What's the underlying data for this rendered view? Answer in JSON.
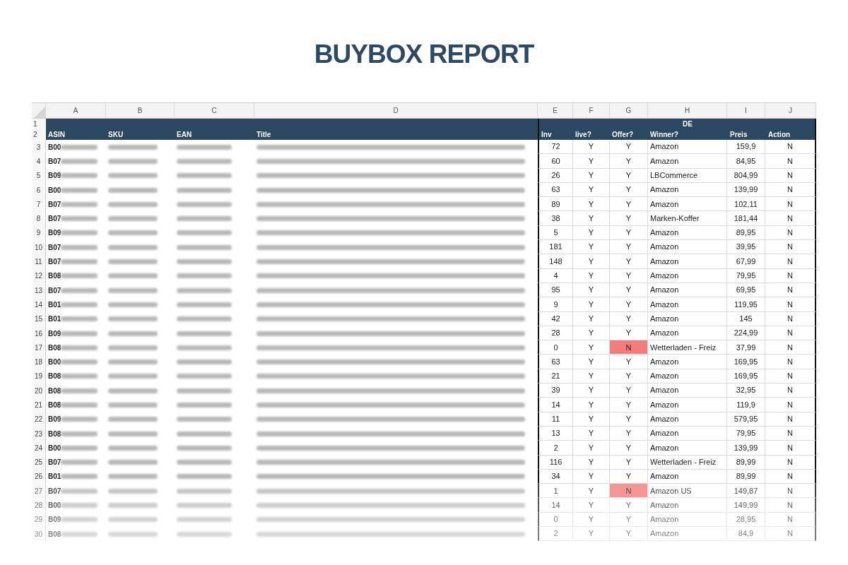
{
  "title": "BUYBOX REPORT",
  "column_letters": [
    "A",
    "B",
    "C",
    "D",
    "E",
    "F",
    "G",
    "H",
    "I",
    "J"
  ],
  "header": {
    "row_numbers": [
      "1",
      "2"
    ],
    "group_label": "DE",
    "columns": [
      "ASIN",
      "SKU",
      "EAN",
      "Title",
      "Inv",
      "live?",
      "Offer?",
      "Winner?",
      "Preis",
      "Action"
    ]
  },
  "rows": [
    {
      "number": "3",
      "asin": "B00",
      "inv": "72",
      "live": "Y",
      "offer": "Y",
      "offer_alert": false,
      "winner": "Amazon",
      "preis": "159,9",
      "action": "N"
    },
    {
      "number": "4",
      "asin": "B07",
      "inv": "60",
      "live": "Y",
      "offer": "Y",
      "offer_alert": false,
      "winner": "Amazon",
      "preis": "84,95",
      "action": "N"
    },
    {
      "number": "5",
      "asin": "B09",
      "inv": "26",
      "live": "Y",
      "offer": "Y",
      "offer_alert": false,
      "winner": "LBCommerce",
      "preis": "804,99",
      "action": "N"
    },
    {
      "number": "6",
      "asin": "B00",
      "inv": "63",
      "live": "Y",
      "offer": "Y",
      "offer_alert": false,
      "winner": "Amazon",
      "preis": "139,99",
      "action": "N"
    },
    {
      "number": "7",
      "asin": "B07",
      "inv": "89",
      "live": "Y",
      "offer": "Y",
      "offer_alert": false,
      "winner": "Amazon",
      "preis": "102,11",
      "action": "N"
    },
    {
      "number": "8",
      "asin": "B07",
      "inv": "38",
      "live": "Y",
      "offer": "Y",
      "offer_alert": false,
      "winner": "Marken-Koffer",
      "preis": "181,44",
      "action": "N"
    },
    {
      "number": "9",
      "asin": "B09",
      "inv": "5",
      "live": "Y",
      "offer": "Y",
      "offer_alert": false,
      "winner": "Amazon",
      "preis": "89,95",
      "action": "N"
    },
    {
      "number": "10",
      "asin": "B07",
      "inv": "181",
      "live": "Y",
      "offer": "Y",
      "offer_alert": false,
      "winner": "Amazon",
      "preis": "39,95",
      "action": "N"
    },
    {
      "number": "11",
      "asin": "B07",
      "inv": "148",
      "live": "Y",
      "offer": "Y",
      "offer_alert": false,
      "winner": "Amazon",
      "preis": "67,99",
      "action": "N"
    },
    {
      "number": "12",
      "asin": "B08",
      "inv": "4",
      "live": "Y",
      "offer": "Y",
      "offer_alert": false,
      "winner": "Amazon",
      "preis": "79,95",
      "action": "N"
    },
    {
      "number": "13",
      "asin": "B07",
      "inv": "95",
      "live": "Y",
      "offer": "Y",
      "offer_alert": false,
      "winner": "Amazon",
      "preis": "69,95",
      "action": "N"
    },
    {
      "number": "14",
      "asin": "B01",
      "inv": "9",
      "live": "Y",
      "offer": "Y",
      "offer_alert": false,
      "winner": "Amazon",
      "preis": "119,95",
      "action": "N"
    },
    {
      "number": "15",
      "asin": "B01",
      "inv": "42",
      "live": "Y",
      "offer": "Y",
      "offer_alert": false,
      "winner": "Amazon",
      "preis": "145",
      "action": "N"
    },
    {
      "number": "16",
      "asin": "B09",
      "inv": "28",
      "live": "Y",
      "offer": "Y",
      "offer_alert": false,
      "winner": "Amazon",
      "preis": "224,99",
      "action": "N"
    },
    {
      "number": "17",
      "asin": "B08",
      "inv": "0",
      "live": "Y",
      "offer": "N",
      "offer_alert": true,
      "winner": "Wetterladen - Freiz",
      "preis": "37,99",
      "action": "N"
    },
    {
      "number": "18",
      "asin": "B00",
      "inv": "63",
      "live": "Y",
      "offer": "Y",
      "offer_alert": false,
      "winner": "Amazon",
      "preis": "169,95",
      "action": "N"
    },
    {
      "number": "19",
      "asin": "B08",
      "inv": "21",
      "live": "Y",
      "offer": "Y",
      "offer_alert": false,
      "winner": "Amazon",
      "preis": "169,95",
      "action": "N"
    },
    {
      "number": "20",
      "asin": "B08",
      "inv": "39",
      "live": "Y",
      "offer": "Y",
      "offer_alert": false,
      "winner": "Amazon",
      "preis": "32,95",
      "action": "N"
    },
    {
      "number": "21",
      "asin": "B08",
      "inv": "14",
      "live": "Y",
      "offer": "Y",
      "offer_alert": false,
      "winner": "Amazon",
      "preis": "119,9",
      "action": "N"
    },
    {
      "number": "22",
      "asin": "B09",
      "inv": "11",
      "live": "Y",
      "offer": "Y",
      "offer_alert": false,
      "winner": "Amazon",
      "preis": "579,95",
      "action": "N"
    },
    {
      "number": "23",
      "asin": "B08",
      "inv": "13",
      "live": "Y",
      "offer": "Y",
      "offer_alert": false,
      "winner": "Amazon",
      "preis": "79,95",
      "action": "N"
    },
    {
      "number": "24",
      "asin": "B00",
      "inv": "2",
      "live": "Y",
      "offer": "Y",
      "offer_alert": false,
      "winner": "Amazon",
      "preis": "139,99",
      "action": "N"
    },
    {
      "number": "25",
      "asin": "B07",
      "inv": "116",
      "live": "Y",
      "offer": "Y",
      "offer_alert": false,
      "winner": "Wetterladen - Freiz",
      "preis": "89,99",
      "action": "N"
    },
    {
      "number": "26",
      "asin": "B01",
      "inv": "34",
      "live": "Y",
      "offer": "Y",
      "offer_alert": false,
      "winner": "Amazon",
      "preis": "89,99",
      "action": "N"
    },
    {
      "number": "27",
      "asin": "B07",
      "inv": "1",
      "live": "Y",
      "offer": "N",
      "offer_alert": true,
      "winner": "Amazon US",
      "preis": "149,87",
      "action": "N"
    },
    {
      "number": "28",
      "asin": "B00",
      "inv": "14",
      "live": "Y",
      "offer": "Y",
      "offer_alert": false,
      "winner": "Amazon",
      "preis": "149,99",
      "action": "N"
    },
    {
      "number": "29",
      "asin": "B09",
      "inv": "0",
      "live": "Y",
      "offer": "Y",
      "offer_alert": false,
      "winner": "Amazon",
      "preis": "28,95",
      "action": "N"
    },
    {
      "number": "30",
      "asin": "B08",
      "inv": "2",
      "live": "Y",
      "offer": "Y",
      "offer_alert": false,
      "winner": "Amazon",
      "preis": "84,9",
      "action": "N"
    }
  ]
}
